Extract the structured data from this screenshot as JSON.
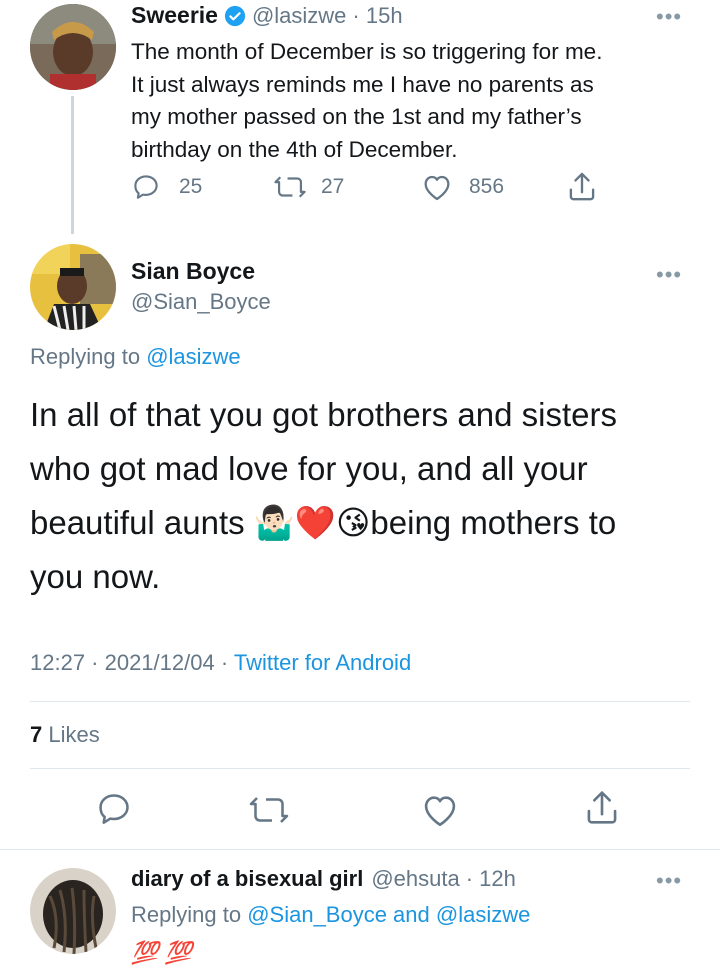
{
  "tweet1": {
    "display_name": "Sweerie",
    "handle": "@lasizwe",
    "time": "· 15h",
    "text_lines": [
      "The month of December is so triggering for me.",
      "It just always reminds me I have no parents as",
      "my mother passed on the 1st and my father’s",
      "birthday on the 4th of December."
    ],
    "replies": "25",
    "retweets": "27",
    "likes": "856"
  },
  "tweet2": {
    "display_name": "Sian Boyce",
    "handle": "@Sian_Boyce",
    "replying_prefix": "Replying to",
    "replying_handle": "@lasizwe",
    "text_lines": [
      "In all of that you got brothers and sisters",
      "who got mad love for you, and all your",
      "beautiful aunts 🤷🏻‍♂️❤️😘being mothers to",
      "you now."
    ],
    "meta_time": "12:27 · 2021/12/04 · ",
    "meta_source": "Twitter for Android",
    "likes_count": "7",
    "likes_label": "Likes"
  },
  "tweet3": {
    "display_name": "diary of a bisexual girl",
    "handle": "@ehsuta",
    "time": "· 12h",
    "replying_prefix": "Replying to",
    "replying_handles": "@Sian_Boyce and @lasizwe",
    "text": "💯 💯"
  },
  "icons": {
    "verified": "verified-badge-icon",
    "reply": "reply-icon",
    "retweet": "retweet-icon",
    "like": "heart-icon",
    "share": "share-icon",
    "more": "more-dots-icon"
  },
  "colors": {
    "link": "#1b95e0",
    "muted": "#657786",
    "verified": "#1da1f2"
  }
}
